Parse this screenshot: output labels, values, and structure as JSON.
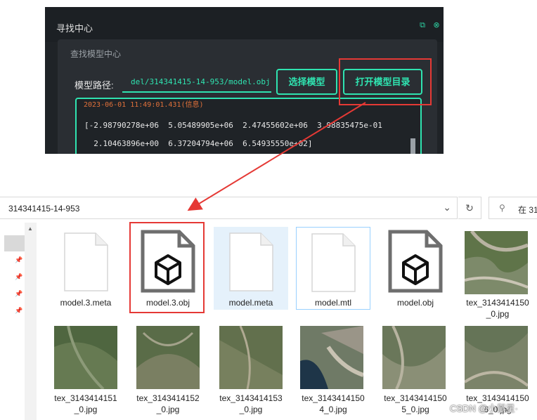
{
  "app": {
    "window_title": "寻找中心",
    "panel_title": "查找模型中心",
    "path_label": "模型路径:",
    "path_value": "del/314341415-14-953/model.obj",
    "select_button": "选择模型",
    "open_dir_button": "打开模型目录",
    "log_lines": [
      "2023-06-01 11:49:01.431(信息)",
      "[-2.98790278e+06  5.05489905e+06  2.47455602e+06  3.98835475e-01",
      "  2.10463896e+00  6.37204794e+06  6.54935550e+02]"
    ]
  },
  "explorer": {
    "address": "314341415-14-953",
    "search_text": "在 31",
    "files": [
      {
        "name": "model.3.meta",
        "icon": "blank-document-icon"
      },
      {
        "name": "model.3.obj",
        "icon": "3d-model-icon"
      },
      {
        "name": "model.meta",
        "icon": "blank-document-icon"
      },
      {
        "name": "model.mtl",
        "icon": "blank-document-icon"
      },
      {
        "name": "model.obj",
        "icon": "3d-model-icon"
      },
      {
        "name": "tex_3143414150_0.jpg",
        "caption1": "tex_3143414150",
        "caption2": "_0.jpg",
        "icon": "satellite-thumbnail"
      },
      {
        "caption1": "tex_3143414151",
        "caption2": "_0.jpg",
        "icon": "satellite-thumbnail"
      },
      {
        "caption1": "tex_3143414152",
        "caption2": "_0.jpg",
        "icon": "satellite-thumbnail"
      },
      {
        "caption1": "tex_3143414153",
        "caption2": "_0.jpg",
        "icon": "satellite-thumbnail"
      },
      {
        "caption1": "tex_3143414150",
        "caption2": "4_0.jpg",
        "icon": "satellite-thumbnail"
      },
      {
        "caption1": "tex_3143414150",
        "caption2": "5_0.jpg",
        "icon": "satellite-thumbnail"
      },
      {
        "caption1": "tex_3143414150",
        "caption2": "6_0.jpg",
        "icon": "satellite-thumbnail"
      }
    ]
  },
  "watermark": "CSDN @小鼠星·",
  "colors": {
    "accent": "#2fe3b0",
    "highlight_red": "#e53935",
    "app_bg": "#1f2327"
  }
}
